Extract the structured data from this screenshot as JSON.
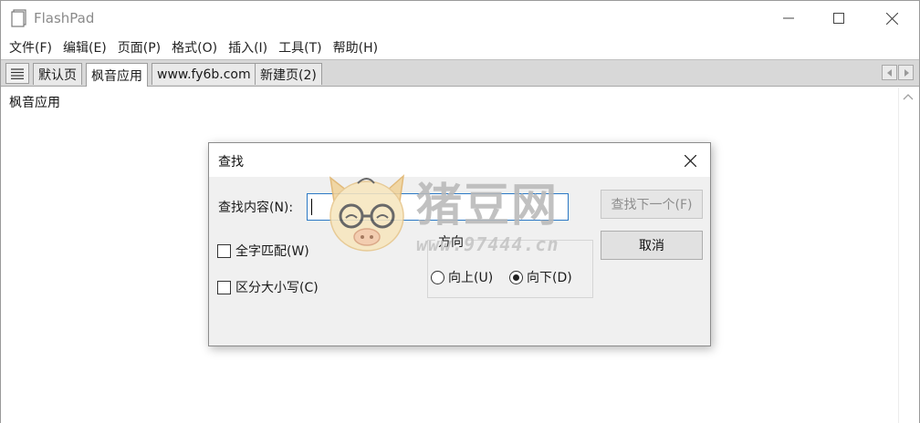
{
  "app": {
    "title": "FlashPad"
  },
  "menu": {
    "items": [
      {
        "label": "文件(F)"
      },
      {
        "label": "编辑(E)"
      },
      {
        "label": "页面(P)"
      },
      {
        "label": "格式(O)"
      },
      {
        "label": "插入(I)"
      },
      {
        "label": "工具(T)"
      },
      {
        "label": "帮助(H)"
      }
    ]
  },
  "tabs": {
    "items": [
      {
        "label": "默认页",
        "active": false
      },
      {
        "label": "枫音应用",
        "active": true
      },
      {
        "label": "www.fy6b.com",
        "active": false
      },
      {
        "label": "新建页(2)",
        "active": false
      }
    ]
  },
  "editor": {
    "content": "枫音应用"
  },
  "dialog": {
    "title": "查找",
    "find_label": "查找内容(N):",
    "find_value": "",
    "find_next_label": "查找下一个(F)",
    "find_next_enabled": false,
    "cancel_label": "取消",
    "whole_word_label": "全字匹配(W)",
    "whole_word_checked": false,
    "match_case_label": "区分大小写(C)",
    "match_case_checked": false,
    "direction_label": "方向",
    "dir_up_label": "向上(U)",
    "dir_down_label": "向下(D)",
    "direction_selected": "down"
  },
  "watermark": {
    "title": "猪豆网",
    "url": "www.97444.cn"
  },
  "colors": {
    "input_border": "#2b78c5",
    "dialog_bg": "#f0f0f0",
    "tabbar_bg": "#d8d8d8"
  }
}
